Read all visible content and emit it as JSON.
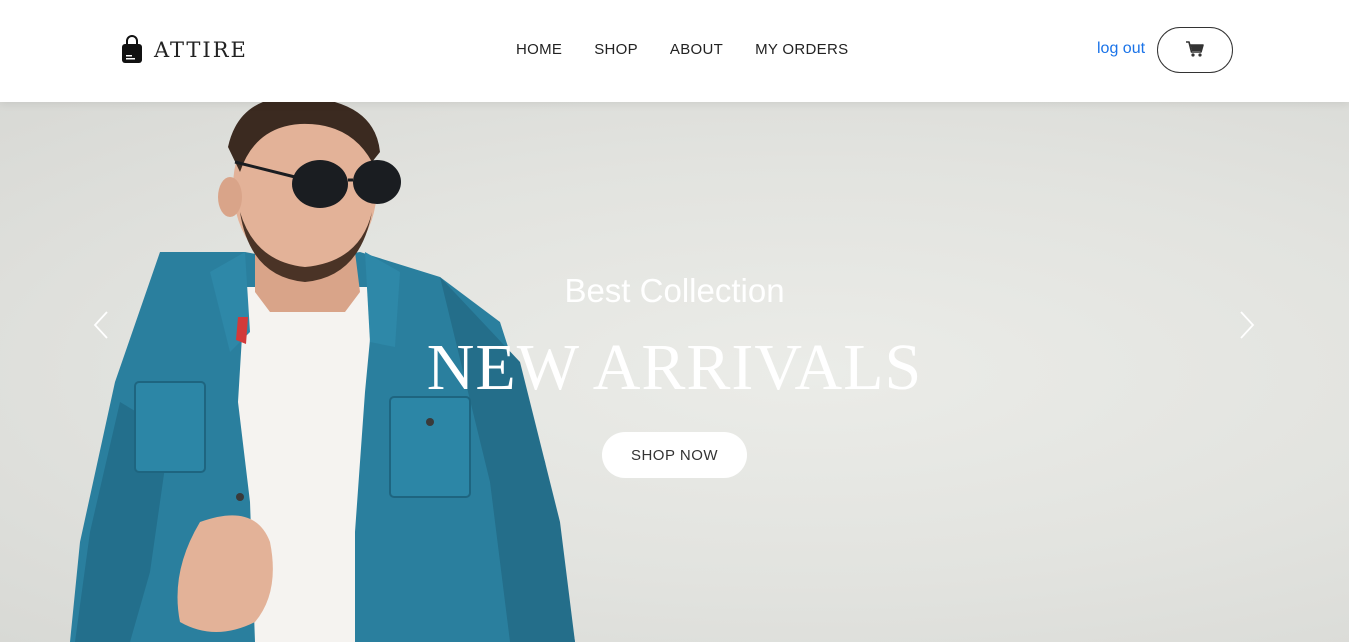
{
  "header": {
    "brand": {
      "name": "ATTIRE",
      "icon": "shopping-bag-icon"
    },
    "nav": [
      {
        "label": "HOME"
      },
      {
        "label": "SHOP"
      },
      {
        "label": "ABOUT"
      },
      {
        "label": "MY ORDERS"
      }
    ],
    "logout_label": "log out",
    "cart_icon": "cart-icon"
  },
  "hero": {
    "subtitle": "Best Collection",
    "title": "NEW ARRIVALS",
    "cta_label": "SHOP NOW",
    "prev_icon": "chevron-left-icon",
    "next_icon": "chevron-right-icon"
  },
  "colors": {
    "link": "#1a73e8",
    "hero_bg": "#e6e7e3",
    "jacket": "#2a7f9e"
  }
}
